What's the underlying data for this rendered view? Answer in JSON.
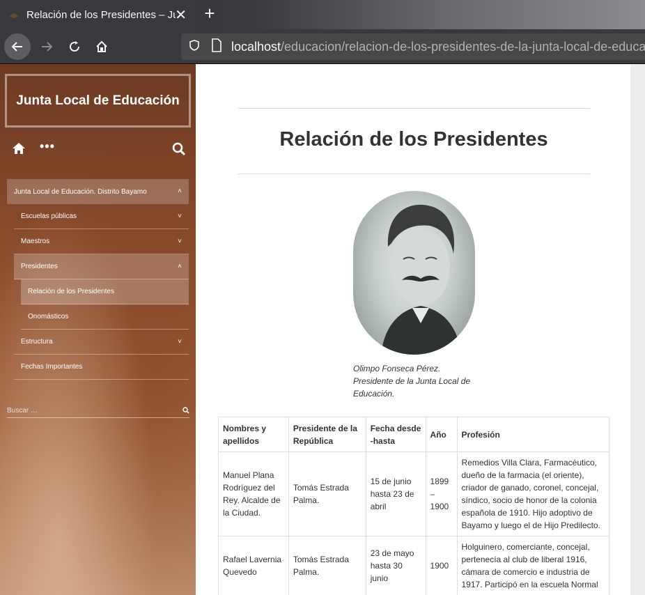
{
  "browser": {
    "tab_title": "Relación de los Presidentes – Ju",
    "url_host": "localhost",
    "url_path": "/educacion/relacion-de-los-presidentes-de-la-junta-local-de-educaci"
  },
  "sidebar": {
    "site_title": "Junta Local de Educación",
    "menu": [
      {
        "label": "Junta Local de Educación. Distrito Bayamo",
        "chevron": "˄"
      },
      {
        "label": "Escuelas públicas",
        "chevron": "˅"
      },
      {
        "label": "Maestros",
        "chevron": "˅"
      },
      {
        "label": "Presidentes",
        "chevron": "˄"
      },
      {
        "label": "Relación de los Presidentes"
      },
      {
        "label": "Onomásticos"
      },
      {
        "label": "Estructura",
        "chevron": "˅"
      },
      {
        "label": "Fechas Importantes"
      }
    ],
    "search_placeholder": "Buscar …"
  },
  "main": {
    "title": "Relación de los Presidentes",
    "caption": [
      "Olimpo Fonseca Pérez.",
      "Presidente de la Junta Local de",
      "Educación."
    ],
    "table": {
      "headers": [
        "Nombres y apellidos",
        "Presidente de la República",
        "Fecha desde -hasta",
        "Año",
        "Profesión"
      ],
      "rows": [
        [
          "Manuel Plana Rodríguez del Rey. Alcalde de la Ciudad.",
          "Tomás Estrada Palma.",
          "15 de junio hasta 23 de abril",
          "1899 – 1900",
          "Remedios Villa Clara, Farmacéutico, dueño de la farmacia (el oriente), criador de ganado, coronel, concejal, síndico, socio de honor de la colonia española de 1910. Hijo adoptivo de Bayamo y luego el de Hijo Predilecto."
        ],
        [
          "Rafael Lavernia Quevedo",
          "Tomás Estrada Palma.",
          "23 de mayo hasta 30 junio",
          "1900",
          "Holguinero, comerciante, concejal, pertenecía al club de liberal 1916, cámara de comercio e industria de 1917. Participó en la escuela Normal"
        ]
      ]
    }
  },
  "colors": {
    "sidebar_brown": "#8a4c2c",
    "chrome_dark": "#38383d"
  }
}
